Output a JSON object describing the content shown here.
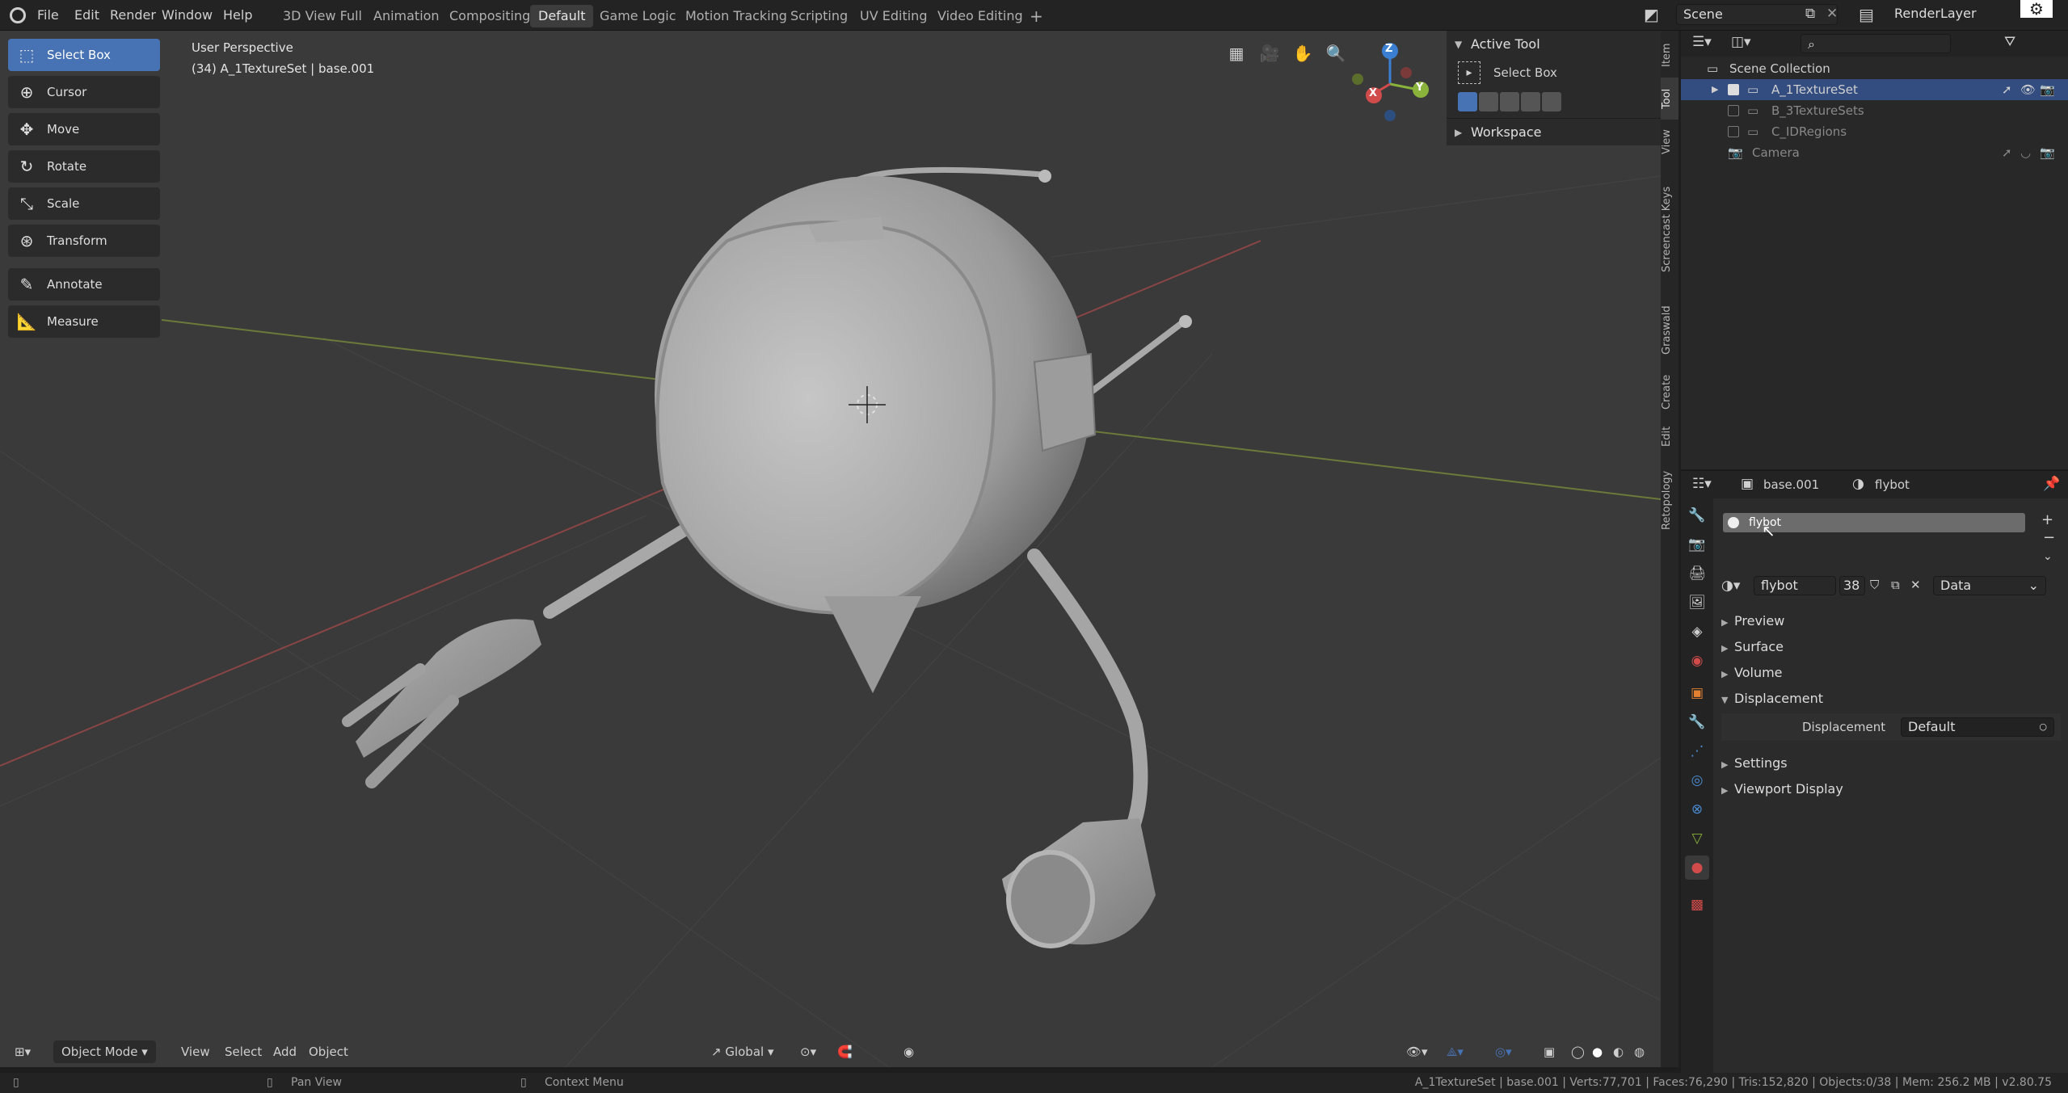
{
  "menu": [
    "File",
    "Edit",
    "Render",
    "Window",
    "Help"
  ],
  "workspaces": [
    "3D View Full",
    "Animation",
    "Compositing",
    "Default",
    "Game Logic",
    "Motion Tracking",
    "Scripting",
    "UV Editing",
    "Video Editing"
  ],
  "workspace_active": "Default",
  "workspace_add": "+",
  "scene": {
    "name": "Scene",
    "render_layer": "RenderLayer"
  },
  "tools": [
    "Select Box",
    "Cursor",
    "Move",
    "Rotate",
    "Scale",
    "Transform",
    "Annotate",
    "Measure"
  ],
  "viewport": {
    "perspective": "User Perspective",
    "object_info": "(34) A_1TextureSet | base.001",
    "gizmo_axes": [
      "Z",
      "Y",
      "X"
    ]
  },
  "npanel": {
    "active_tool_header": "Active Tool",
    "active_tool_name": "Select Box",
    "workspace_header": "Workspace",
    "tabs": [
      "Item",
      "Tool",
      "View",
      "Screencast Keys",
      "Graswald",
      "Create",
      "Edit",
      "Retopology"
    ],
    "active_tab": "Tool"
  },
  "viewport_footer": {
    "mode": "Object Mode",
    "menus": [
      "View",
      "Select",
      "Add",
      "Object"
    ],
    "transform_orientation": "Global"
  },
  "status": {
    "left": "Pan View",
    "middle": "Context Menu",
    "right": "A_1TextureSet | base.001 | Verts:77,701 | Faces:76,290 | Tris:152,820 | Objects:0/38 | Mem: 256.2 MB | v2.80.75"
  },
  "outliner": {
    "root": "Scene Collection",
    "items": [
      {
        "name": "A_1TextureSet",
        "selected": true
      },
      {
        "name": "B_3TextureSets",
        "selected": false
      },
      {
        "name": "C_IDRegions",
        "selected": false
      },
      {
        "name": "Camera",
        "selected": false
      }
    ]
  },
  "properties": {
    "object": "base.001",
    "material": "flybot",
    "slot": "flybot",
    "mat_name": "flybot",
    "users": "38",
    "link": "Data",
    "sections": [
      "Preview",
      "Surface",
      "Volume",
      "Displacement",
      "Settings",
      "Viewport Display"
    ],
    "displacement_label": "Displacement",
    "displacement_value": "Default"
  },
  "colors": {
    "accent": "#4772b3",
    "x_axis": "#d24b4b",
    "y_axis": "#8ab33b",
    "z_axis": "#3b7fd2"
  }
}
